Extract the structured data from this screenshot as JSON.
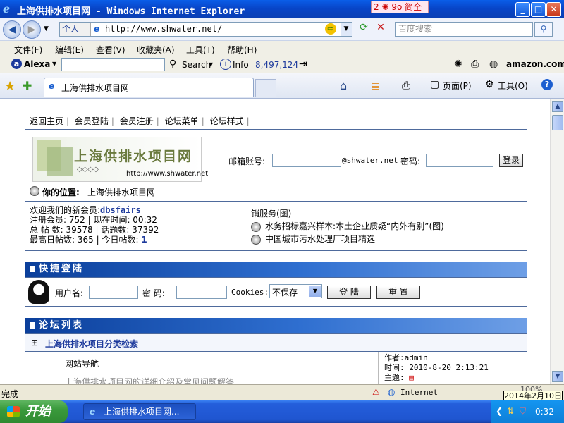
{
  "window": {
    "title": "上海供排水项目网 - Windows Internet Explorer",
    "tray_tool": "2 ✺ 9o 简全",
    "buttons": {
      "minimize": "_",
      "maximize": "□",
      "close": "✕"
    }
  },
  "address": {
    "personal_label": "个人",
    "url": "http://www.shwater.net/",
    "search_placeholder": "百度搜索"
  },
  "menus": [
    "文件(F)",
    "编辑(E)",
    "查看(V)",
    "收藏夹(A)",
    "工具(T)",
    "帮助(H)"
  ],
  "alexa": {
    "brand": "Alexa",
    "search_label": "Search",
    "info_label": "Info",
    "rank": "8,497,124",
    "amazon": "amazon.com."
  },
  "tabbar": {
    "tab_title": "上海供排水项目网",
    "page_label": "页面(P)",
    "tools_label": "工具(O)"
  },
  "page": {
    "topnav": [
      "返回主页",
      "会员登陆",
      "会员注册",
      "论坛菜单",
      "论坛样式"
    ],
    "logo_text": "上海供排水项目网",
    "logo_dots": "◇◇◇◇",
    "logo_url": "http://www.shwater.net",
    "login": {
      "email_label": "邮箱账号:",
      "email_suffix": "@shwater.net",
      "password_label": "密码:",
      "login_button": "登录"
    },
    "location_label": "你的位置:",
    "location_value": "上海供排水项目网",
    "stats": {
      "welcome_prefix": "欢迎我们的新会员:",
      "new_member": "dbsfairs",
      "reg_members": "注册会员: 752",
      "current_time": "现在时间: 00:32",
      "total_posts": "总 帖 数: 39578",
      "topics": "话题数: 37392",
      "max_daily": "最高日帖数: 365",
      "today_prefix": "今日帖数:",
      "today_value": "1"
    },
    "news": [
      "销服务(图)",
      "水务招标嘉兴样本:本土企业质疑“内外有别”(图)",
      "中国城市污水处理厂项目精选"
    ],
    "quick_login": {
      "title": "快捷登陆",
      "username_label": "用户名:",
      "password_label": "密 码:",
      "cookies_label": "Cookies:",
      "cookies_value": "不保存",
      "login_button": "登 陆",
      "reset_button": "重 置"
    },
    "forum_list": {
      "title": "论坛列表",
      "category_toggle": "⊞",
      "category": "上海供排水项目分类检索",
      "forum_name": "网站导航",
      "forum_desc": "上海供排水项目网的详细介绍及常见问题解答",
      "author": "作者:admin",
      "time": "时间: 2010-8-20 2:13:21",
      "topic": "主题:"
    }
  },
  "status": {
    "text": "完成",
    "zone": "Internet",
    "zoom": "100%",
    "date_tooltip": "2014年2月10日"
  },
  "taskbar": {
    "start": "开始",
    "task": "上海供排水项目网...",
    "clock": "0:32"
  }
}
